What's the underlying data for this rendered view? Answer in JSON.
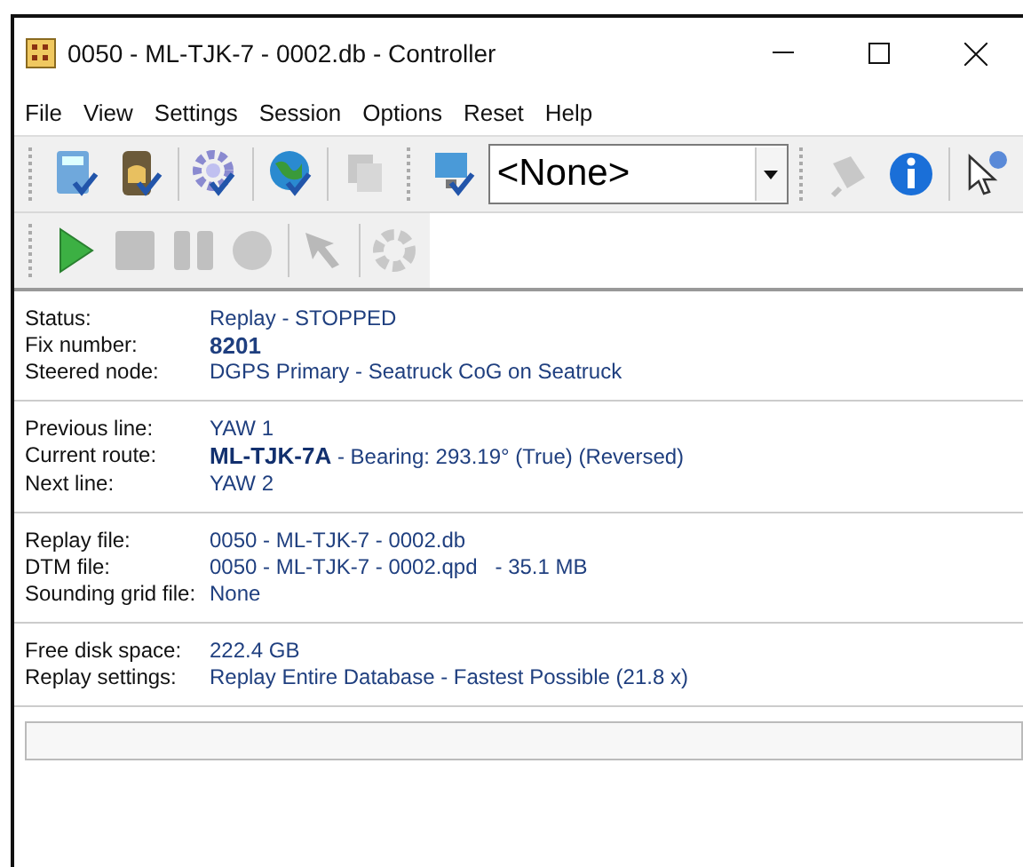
{
  "window": {
    "title": "0050 - ML-TJK-7 - 0002.db - Controller"
  },
  "menu": [
    "File",
    "View",
    "Settings",
    "Session",
    "Options",
    "Reset",
    "Help"
  ],
  "toolbar": [
    {
      "kind": "calculator",
      "disabled": false
    },
    {
      "kind": "device",
      "disabled": false
    },
    {
      "kind": "gear",
      "disabled": false
    },
    {
      "kind": "globe",
      "disabled": false
    },
    {
      "kind": "copy",
      "disabled": true
    },
    {
      "kind": "monitor",
      "disabled": false
    }
  ],
  "dropdown": {
    "value": "<None>"
  },
  "toolbar_right": [
    {
      "kind": "plug",
      "disabled": true
    },
    {
      "kind": "info",
      "disabled": false
    },
    {
      "kind": "help-pointer",
      "disabled": false
    }
  ],
  "playback": [
    {
      "kind": "play",
      "disabled": false
    },
    {
      "kind": "stop",
      "disabled": true
    },
    {
      "kind": "pause",
      "disabled": true
    },
    {
      "kind": "record",
      "disabled": true
    },
    {
      "kind": "arrow",
      "disabled": true
    },
    {
      "kind": "lifebuoy",
      "disabled": true
    }
  ],
  "sections": [
    [
      {
        "label": "Status:",
        "value": "Replay - STOPPED",
        "bold": false
      },
      {
        "label": "Fix number:",
        "value": "8201",
        "bold": true
      },
      {
        "label": "Steered node:",
        "value": "DGPS Primary - Seatruck CoG on Seatruck",
        "bold": false
      }
    ],
    [
      {
        "label": "Previous line:",
        "value": "YAW 1",
        "bold": false
      },
      {
        "label": "Current route:",
        "value": "**ML-TJK-7A** - Bearing: 293.19° (True) (Reversed)",
        "bold": false
      },
      {
        "label": "Next line:",
        "value": "YAW 2",
        "bold": false
      }
    ],
    [
      {
        "label": "Replay file:",
        "value": "0050 - ML-TJK-7 - 0002.db",
        "bold": false
      },
      {
        "label": "DTM file:",
        "value": "0050 - ML-TJK-7 - 0002.qpd   - 35.1 MB",
        "bold": false
      },
      {
        "label": "Sounding grid file:",
        "value": "None",
        "bold": false
      }
    ],
    [
      {
        "label": "Free disk space:",
        "value": "222.4 GB",
        "bold": false
      },
      {
        "label": "Replay settings:",
        "value": "Replay Entire Database - Fastest Possible (21.8 x)",
        "bold": false
      }
    ]
  ],
  "progress": {
    "level": 0
  }
}
